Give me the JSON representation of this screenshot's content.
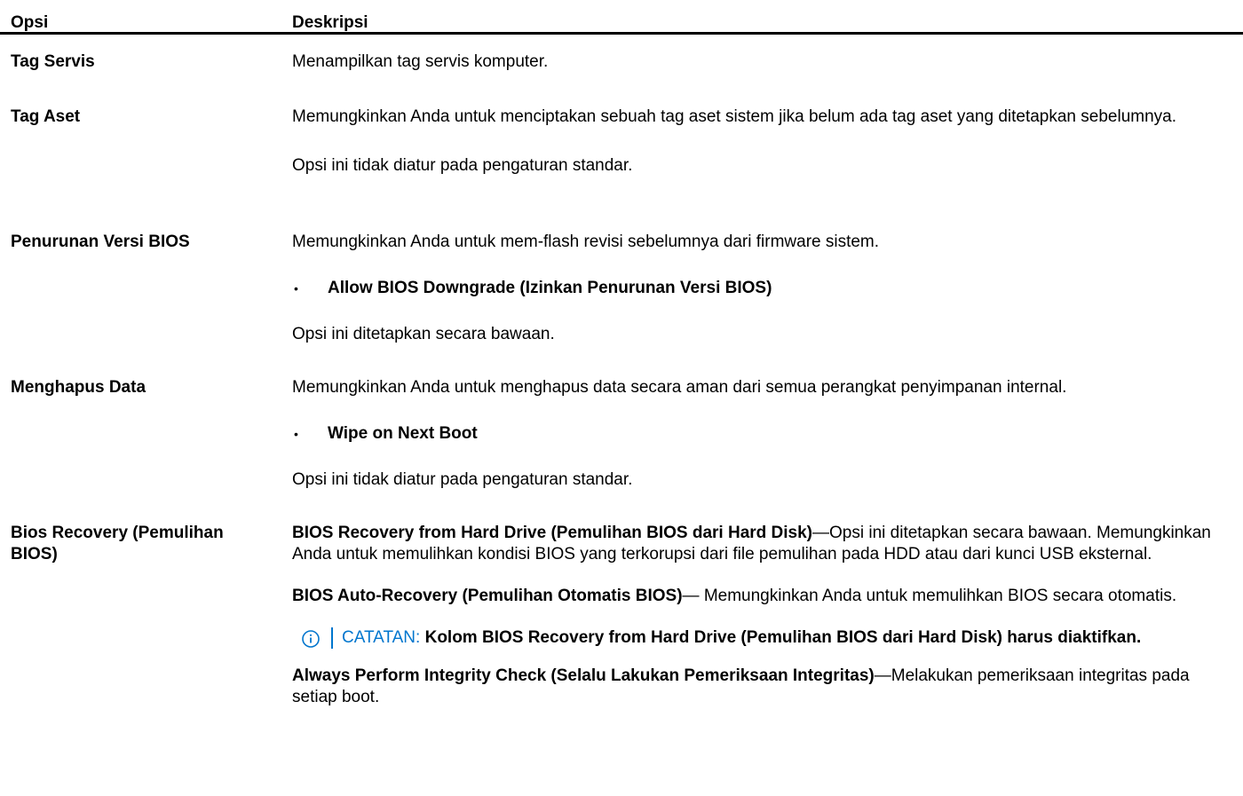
{
  "header": {
    "col_option": "Opsi",
    "col_description": "Deskripsi"
  },
  "rows": [
    {
      "option": "Tag Servis",
      "desc": [
        "Menampilkan tag servis komputer."
      ]
    },
    {
      "option": "Tag Aset",
      "desc": [
        "Memungkinkan Anda untuk menciptakan sebuah tag aset sistem jika belum ada tag aset yang ditetapkan sebelumnya.",
        "Opsi ini tidak diatur pada pengaturan standar."
      ]
    },
    {
      "option": "Penurunan Versi BIOS",
      "desc": [
        "Memungkinkan Anda untuk mem-flash revisi sebelumnya dari firmware sistem.",
        "Opsi ini ditetapkan secara bawaan."
      ],
      "bullet": "Allow BIOS Downgrade (Izinkan Penurunan Versi BIOS)"
    },
    {
      "option": "Menghapus Data",
      "desc": [
        "Memungkinkan Anda untuk menghapus data secara aman dari semua perangkat penyimpanan internal.",
        "Opsi ini tidak diatur pada pengaturan standar."
      ],
      "bullet": "Wipe on Next Boot"
    },
    {
      "option": "Bios Recovery (Pemulihan BIOS)",
      "items": [
        {
          "title": "BIOS Recovery from Hard Drive (Pemulihan BIOS dari Hard Disk)",
          "text": "—Opsi ini ditetapkan secara bawaan. Memungkinkan Anda untuk memulihkan kondisi BIOS yang terkorupsi dari file pemulihan pada HDD atau dari kunci USB eksternal."
        },
        {
          "title": "BIOS Auto-Recovery (Pemulihan Otomatis BIOS)",
          "text": "— Memungkinkan Anda untuk memulihkan BIOS secara otomatis."
        },
        {
          "title": "Always Perform Integrity Check (Selalu Lakukan Pemeriksaan Integritas)",
          "text": "—Melakukan pemeriksaan integritas pada setiap boot."
        }
      ],
      "note": {
        "label": "CATATAN:",
        "text": " Kolom BIOS Recovery from Hard Drive (Pemulihan BIOS dari Hard Disk) harus diaktifkan."
      }
    }
  ],
  "colors": {
    "note_accent": "#0076ce"
  },
  "icons": {
    "note": "info-circle-icon"
  }
}
